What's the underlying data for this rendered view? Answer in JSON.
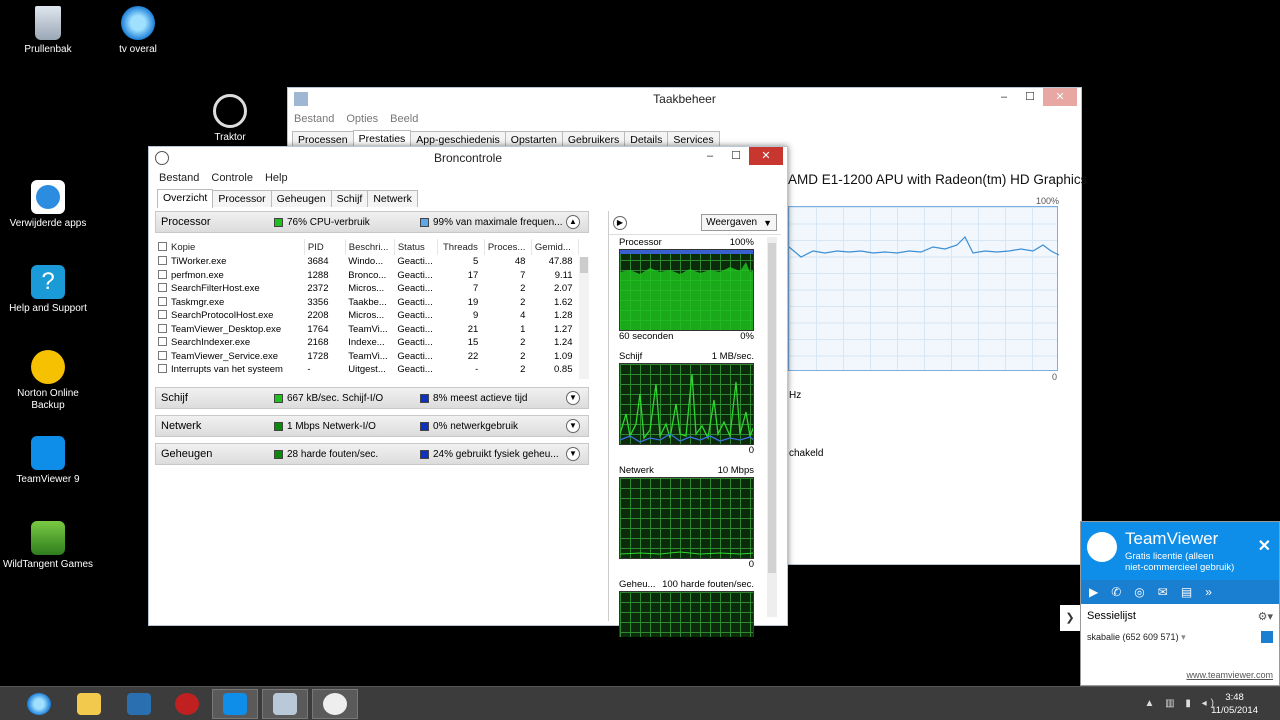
{
  "desktop": {
    "icons": [
      {
        "label": "Prullenbak"
      },
      {
        "label": "tv overal"
      },
      {
        "label": "Traktor"
      },
      {
        "label": "Verwijderde apps"
      },
      {
        "label": "Help and Support"
      },
      {
        "label": "Norton Online Backup"
      },
      {
        "label": "TeamViewer 9"
      },
      {
        "label": "WildTangent Games"
      }
    ]
  },
  "taskmanager": {
    "title": "Taakbeheer",
    "menu": [
      "Bestand",
      "Opties",
      "Beeld"
    ],
    "tabs": [
      "Processen",
      "Prestaties",
      "App-geschiedenis",
      "Opstarten",
      "Gebruikers",
      "Details",
      "Services"
    ],
    "active_tab": "Prestaties",
    "cpu_name": "AMD E1-1200 APU with Radeon(tm) HD Graphics",
    "graph_max": "100%",
    "graph_min": "0",
    "partial_text_1": "Hz",
    "partial_text_2": "chakeld"
  },
  "resmon": {
    "title": "Broncontrole",
    "menu": [
      "Bestand",
      "Controle",
      "Help"
    ],
    "tabs": [
      "Overzicht",
      "Processor",
      "Geheugen",
      "Schijf",
      "Netwerk"
    ],
    "active_tab": "Overzicht",
    "sections": {
      "processor": {
        "name": "Processor",
        "m1": "76% CPU-verbruik",
        "m2": "99% van maximale frequen...",
        "c1": "#1ec01e",
        "c2": "#5fa8e8"
      },
      "schijf": {
        "name": "Schijf",
        "m1": "667 kB/sec. Schijf-I/O",
        "m2": "8% meest actieve tijd",
        "c1": "#1ec01e",
        "c2": "#1030c0"
      },
      "netwerk": {
        "name": "Netwerk",
        "m1": "1 Mbps  Netwerk-I/O",
        "m2": "0% netwerkgebruik",
        "c1": "#0a8a0a",
        "c2": "#1030c0"
      },
      "geheugen": {
        "name": "Geheugen",
        "m1": "28 harde fouten/sec.",
        "m2": "24% gebruikt fysiek geheu...",
        "c1": "#0a8a0a",
        "c2": "#1030c0"
      }
    },
    "columns": [
      "Kopie",
      "PID",
      "Beschri...",
      "Status",
      "Threads",
      "Proces...",
      "Gemid..."
    ],
    "rows": [
      {
        "name": "TiWorker.exe",
        "pid": "3684",
        "desc": "Windo...",
        "status": "Geacti...",
        "threads": "5",
        "proc": "48",
        "avg": "47.88"
      },
      {
        "name": "perfmon.exe",
        "pid": "1288",
        "desc": "Bronco...",
        "status": "Geacti...",
        "threads": "17",
        "proc": "7",
        "avg": "9.11"
      },
      {
        "name": "SearchFilterHost.exe",
        "pid": "2372",
        "desc": "Micros...",
        "status": "Geacti...",
        "threads": "7",
        "proc": "2",
        "avg": "2.07"
      },
      {
        "name": "Taskmgr.exe",
        "pid": "3356",
        "desc": "Taakbe...",
        "status": "Geacti...",
        "threads": "19",
        "proc": "2",
        "avg": "1.62"
      },
      {
        "name": "SearchProtocolHost.exe",
        "pid": "2208",
        "desc": "Micros...",
        "status": "Geacti...",
        "threads": "9",
        "proc": "4",
        "avg": "1.28"
      },
      {
        "name": "TeamViewer_Desktop.exe",
        "pid": "1764",
        "desc": "TeamVi...",
        "status": "Geacti...",
        "threads": "21",
        "proc": "1",
        "avg": "1.27"
      },
      {
        "name": "SearchIndexer.exe",
        "pid": "2168",
        "desc": "Indexe...",
        "status": "Geacti...",
        "threads": "15",
        "proc": "2",
        "avg": "1.24"
      },
      {
        "name": "TeamViewer_Service.exe",
        "pid": "1728",
        "desc": "TeamVi...",
        "status": "Geacti...",
        "threads": "22",
        "proc": "2",
        "avg": "1.09"
      },
      {
        "name": "Interrupts van het systeem",
        "pid": "-",
        "desc": "Uitgest...",
        "status": "Geacti...",
        "threads": "-",
        "proc": "2",
        "avg": "0.85"
      }
    ],
    "right": {
      "button": "Weergaven",
      "graphs": [
        {
          "title": "Processor",
          "max": "100%",
          "foot_l": "60 seconden",
          "foot_r": "0%"
        },
        {
          "title": "Schijf",
          "max": "1 MB/sec.",
          "foot_l": "",
          "foot_r": "0"
        },
        {
          "title": "Netwerk",
          "max": "10 Mbps",
          "foot_l": "",
          "foot_r": "0"
        },
        {
          "title": "Geheu...",
          "max": "100 harde fouten/sec.",
          "foot_l": "",
          "foot_r": ""
        }
      ]
    }
  },
  "teamviewer": {
    "name": "TeamViewer",
    "sub1": "Gratis licentie (alleen",
    "sub2": "niet-commercieel gebruik)",
    "sessions": "Sessielijst",
    "entry": "skabalie (652 609 571)",
    "link": "www.teamviewer.com"
  },
  "taskbar": {
    "time": "3:48",
    "date": "11/05/2014"
  }
}
